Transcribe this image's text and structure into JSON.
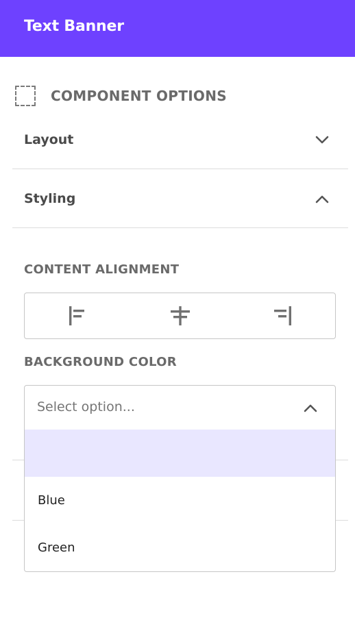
{
  "header": {
    "title": "Text Banner"
  },
  "section": {
    "icon": "dashed-square-icon",
    "title": "COMPONENT OPTIONS"
  },
  "accordion": {
    "layout": {
      "label": "Layout",
      "state": "collapsed",
      "icon": "chevron-down-icon"
    },
    "styling": {
      "label": "Styling",
      "state": "expanded",
      "icon": "chevron-up-icon"
    }
  },
  "content_alignment": {
    "label": "CONTENT ALIGNMENT",
    "options": [
      {
        "name": "align-left",
        "icon": "align-left-icon"
      },
      {
        "name": "align-center",
        "icon": "align-center-icon"
      },
      {
        "name": "align-right",
        "icon": "align-right-icon"
      }
    ]
  },
  "background_color": {
    "label": "BACKGROUND COLOR",
    "placeholder": "Select option...",
    "options": [
      "",
      "Blue",
      "Green"
    ],
    "highlighted_index": 0
  },
  "colors": {
    "header_bg": "#6e41ff",
    "highlight": "#e9e7ff"
  }
}
